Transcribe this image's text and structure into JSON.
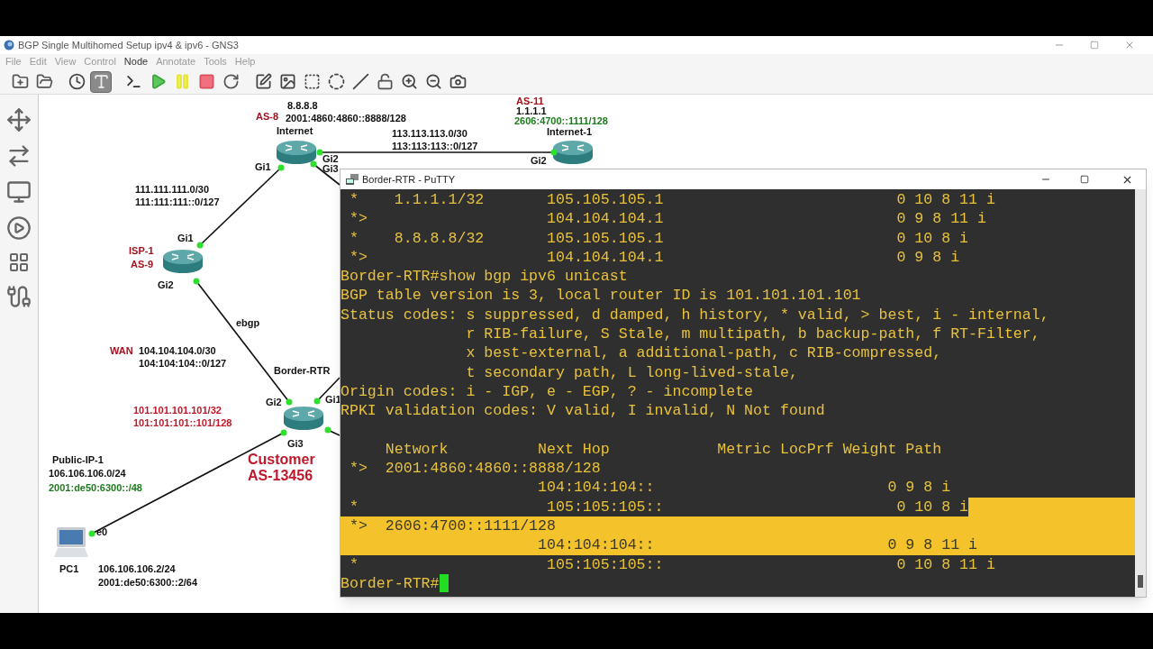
{
  "window": {
    "title": "BGP Single Multihomed Setup ipv4 & ipv6 - GNS3"
  },
  "menu": [
    {
      "label": "File",
      "disabled": true
    },
    {
      "label": "Edit",
      "disabled": true
    },
    {
      "label": "View",
      "disabled": true
    },
    {
      "label": "Control",
      "disabled": true
    },
    {
      "label": "Node",
      "disabled": false
    },
    {
      "label": "Annotate",
      "disabled": true
    },
    {
      "label": "Tools",
      "disabled": true
    },
    {
      "label": "Help",
      "disabled": true
    }
  ],
  "toolbar": [
    {
      "selected": false
    },
    {
      "selected": false
    },
    {
      "selected": false
    },
    {
      "selected": true
    },
    {
      "selected": false
    },
    {
      "selected": false
    },
    {
      "selected": false
    },
    {
      "selected": false
    },
    {
      "selected": false
    },
    {
      "selected": false
    },
    {
      "selected": false
    },
    {
      "selected": false
    },
    {
      "selected": false
    },
    {
      "selected": false
    },
    {
      "selected": false
    },
    {
      "selected": false
    },
    {
      "selected": false
    },
    {
      "selected": false
    }
  ],
  "canvas_labels": [
    {
      "text": "8.8.8.8",
      "color": "#111111",
      "kind": "label"
    },
    {
      "text": "AS-8",
      "color": "#a3121f",
      "kind": "label"
    },
    {
      "text": "2001:4860:4860::8888/128",
      "color": "#111111",
      "kind": "label"
    },
    {
      "text": "Internet",
      "color": "#111111",
      "kind": "label"
    },
    {
      "text": "113.113.113.0/30",
      "color": "#111111",
      "kind": "label"
    },
    {
      "text": "113:113:113::0/127",
      "color": "#111111",
      "kind": "label"
    },
    {
      "text": "AS-11",
      "color": "#a3121f",
      "kind": "label"
    },
    {
      "text": "1.1.1.1",
      "color": "#111111",
      "kind": "label"
    },
    {
      "text": "2606:4700::1111/128",
      "color": "#1f7a1f",
      "kind": "label"
    },
    {
      "text": "Internet-1",
      "color": "#111111",
      "kind": "label"
    },
    {
      "text": "Gi2",
      "color": "#111111",
      "kind": "label"
    },
    {
      "text": "Gi3",
      "color": "#111111",
      "kind": "label"
    },
    {
      "text": "Gi1",
      "color": "#111111",
      "kind": "label"
    },
    {
      "text": "Gi2",
      "color": "#111111",
      "kind": "label"
    },
    {
      "text": "111.111.111.0/30",
      "color": "#111111",
      "kind": "label"
    },
    {
      "text": "111:111:111::0/127",
      "color": "#111111",
      "kind": "label"
    },
    {
      "text": "Gi1",
      "color": "#111111",
      "kind": "label"
    },
    {
      "text": "ISP-1",
      "color": "#a3121f",
      "kind": "label"
    },
    {
      "text": "AS-9",
      "color": "#a3121f",
      "kind": "label"
    },
    {
      "text": "Gi2",
      "color": "#111111",
      "kind": "label"
    },
    {
      "text": "ebgp",
      "color": "#111111",
      "kind": "label"
    },
    {
      "text": "WAN",
      "color": "#a3121f",
      "kind": "label"
    },
    {
      "text": "104.104.104.0/30",
      "color": "#111111",
      "kind": "label"
    },
    {
      "text": "104:104:104::0/127",
      "color": "#111111",
      "kind": "label"
    },
    {
      "text": "Border-RTR",
      "color": "#111111",
      "kind": "label"
    },
    {
      "text": "Gi2",
      "color": "#111111",
      "kind": "label"
    },
    {
      "text": "Gi1",
      "color": "#111111",
      "kind": "label"
    },
    {
      "text": "101.101.101.101/32",
      "color": "#c0182a",
      "kind": "label"
    },
    {
      "text": "101:101:101::101/128",
      "color": "#c0182a",
      "kind": "label"
    },
    {
      "text": "Gi3",
      "color": "#111111",
      "kind": "label"
    },
    {
      "text": "Public-IP-1",
      "color": "#111111",
      "kind": "label"
    },
    {
      "text": "106.106.106.0/24",
      "color": "#111111",
      "kind": "label"
    },
    {
      "text": "2001:de50:6300::/48",
      "color": "#1f7a1f",
      "kind": "label"
    },
    {
      "text": "Customer",
      "color": "#c0182a",
      "kind": "title"
    },
    {
      "text": "AS-13456",
      "color": "#c0182a",
      "kind": "title"
    },
    {
      "text": "e0",
      "color": "#111111",
      "kind": "label"
    },
    {
      "text": "PC1",
      "color": "#111111",
      "kind": "label"
    },
    {
      "text": "106.106.106.2/24",
      "color": "#111111",
      "kind": "label"
    },
    {
      "text": "2001:de50:6300::2/64",
      "color": "#111111",
      "kind": "label"
    }
  ],
  "terminal": {
    "title": "Border-RTR - PuTTY",
    "cursor": true,
    "lines": [
      {
        "text": " *    1.1.1.1/32       105.105.105.1                          0 10 8 11 i",
        "selected": false,
        "tail_selected": false
      },
      {
        "text": " *>                    104.104.104.1                          0 9 8 11 i",
        "selected": false,
        "tail_selected": false
      },
      {
        "text": " *    8.8.8.8/32       105.105.105.1                          0 10 8 i",
        "selected": false,
        "tail_selected": false
      },
      {
        "text": " *>                    104.104.104.1                          0 9 8 i",
        "selected": false,
        "tail_selected": false
      },
      {
        "text": "Border-RTR#show bgp ipv6 unicast",
        "selected": false,
        "tail_selected": false
      },
      {
        "text": "BGP table version is 3, local router ID is 101.101.101.101",
        "selected": false,
        "tail_selected": false
      },
      {
        "text": "Status codes: s suppressed, d damped, h history, * valid, > best, i - internal,",
        "selected": false,
        "tail_selected": false
      },
      {
        "text": "              r RIB-failure, S Stale, m multipath, b backup-path, f RT-Filter,",
        "selected": false,
        "tail_selected": false
      },
      {
        "text": "              x best-external, a additional-path, c RIB-compressed,",
        "selected": false,
        "tail_selected": false
      },
      {
        "text": "              t secondary path, L long-lived-stale,",
        "selected": false,
        "tail_selected": false
      },
      {
        "text": "Origin codes: i - IGP, e - EGP, ? - incomplete",
        "selected": false,
        "tail_selected": false
      },
      {
        "text": "RPKI validation codes: V valid, I invalid, N Not found",
        "selected": false,
        "tail_selected": false
      }
    ],
    "table_lines": [
      {
        "text": "     Network          Next Hop            Metric LocPrf Weight Path",
        "selected": false,
        "tail_selected": false
      },
      {
        "text": " *>  2001:4860:4860::8888/128",
        "selected": false,
        "tail_selected": false
      },
      {
        "text": "                      104:104:104::                          0 9 8 i",
        "selected": false,
        "tail_selected": false
      },
      {
        "text": " *                     105:105:105::                          0 10 8 i",
        "selected": false,
        "tail_selected": true
      },
      {
        "text": " *>  2606:4700::1111/128",
        "selected": true,
        "tail_selected": true
      },
      {
        "text": "                      104:104:104::                          0 9 8 11 i",
        "selected": true,
        "tail_selected": true
      },
      {
        "text": " *                     105:105:105::                          0 10 8 11 i",
        "selected": false,
        "tail_selected": false
      },
      {
        "text": "Border-RTR#",
        "selected": false,
        "tail_selected": false
      }
    ]
  }
}
